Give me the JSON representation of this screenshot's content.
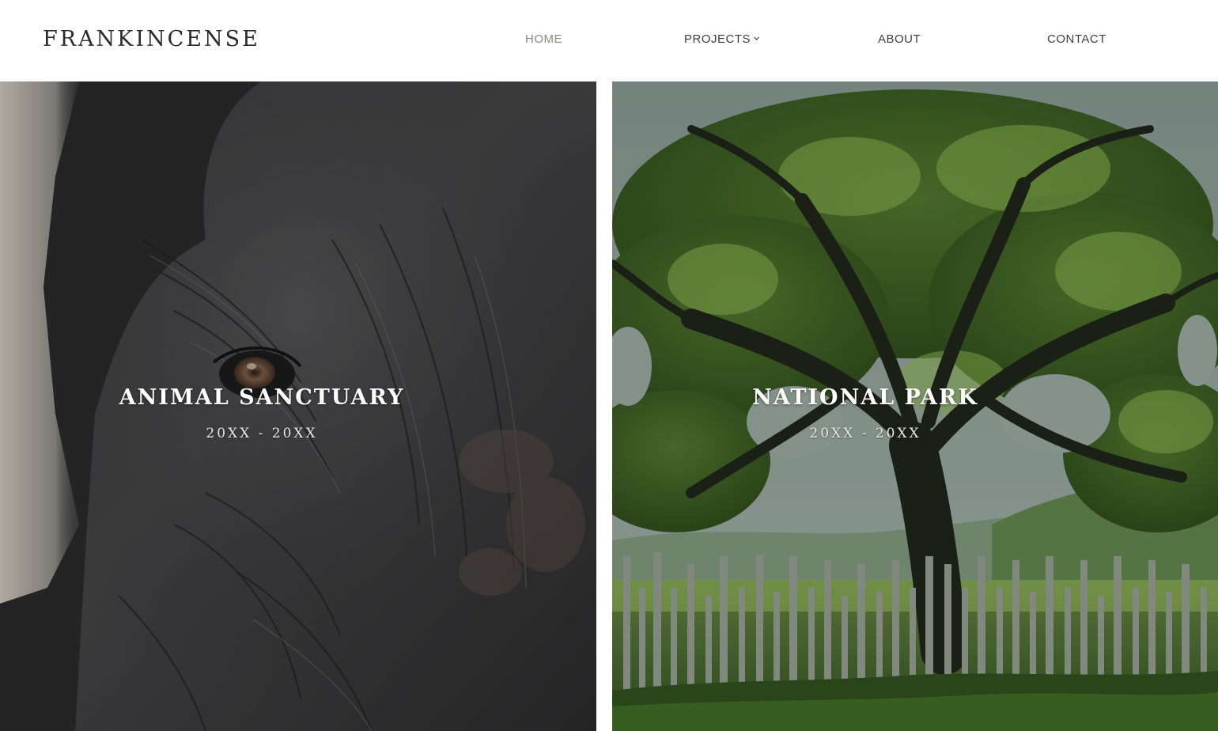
{
  "header": {
    "logo": "FRANKINCENSE",
    "nav": {
      "home": "HOME",
      "projects": "PROJECTS",
      "about": "ABOUT",
      "contact": "CONTACT"
    },
    "active_item": "HOME",
    "colors": {
      "background": "#ffffff",
      "text": "#3f3f3f",
      "active": "#8a8a80"
    }
  },
  "projects": [
    {
      "title": "ANIMAL SANCTUARY",
      "dates": "20XX - 20XX",
      "image": "elephant-eye-closeup"
    },
    {
      "title": "NATIONAL PARK",
      "dates": "20XX - 20XX",
      "image": "oak-tree-with-wooden-fence"
    }
  ],
  "icons": {
    "projects_dropdown": "chevron-down-icon"
  }
}
